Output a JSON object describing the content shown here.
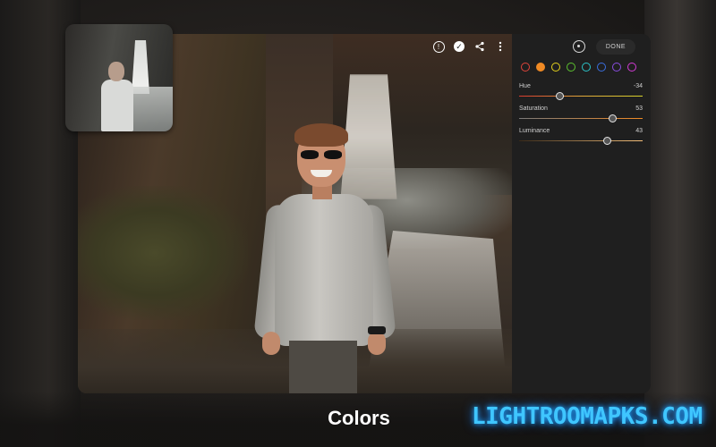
{
  "caption": "Colors",
  "watermark": "LIGHTROOMAPKS.COM",
  "top_icons": [
    "info-icon",
    "check-icon",
    "share-icon",
    "more-vertical-icon"
  ],
  "panel": {
    "done_label": "DONE",
    "target_icon": "target-adjust-icon",
    "color_dots": [
      {
        "name": "red",
        "color": "#e0443a"
      },
      {
        "name": "orange",
        "color": "#f08a24",
        "selected": true
      },
      {
        "name": "yellow",
        "color": "#e6d21c"
      },
      {
        "name": "green",
        "color": "#5cc12f"
      },
      {
        "name": "aqua",
        "color": "#2bc4c9"
      },
      {
        "name": "blue",
        "color": "#3b6fe0"
      },
      {
        "name": "purple",
        "color": "#8a4de2"
      },
      {
        "name": "magenta",
        "color": "#d33bd6"
      }
    ],
    "sliders": [
      {
        "label": "Hue",
        "value": "-34",
        "position": 0.33,
        "gradient": "linear-gradient(90deg,#d83a2f,#e0a63a 50%,#d6d22b)"
      },
      {
        "label": "Saturation",
        "value": "53",
        "position": 0.76,
        "gradient": "linear-gradient(90deg,#7a7a7a,#f08a24)"
      },
      {
        "label": "Luminance",
        "value": "43",
        "position": 0.72,
        "gradient": "linear-gradient(90deg,#3a2a18,#f6c07a)"
      }
    ]
  }
}
